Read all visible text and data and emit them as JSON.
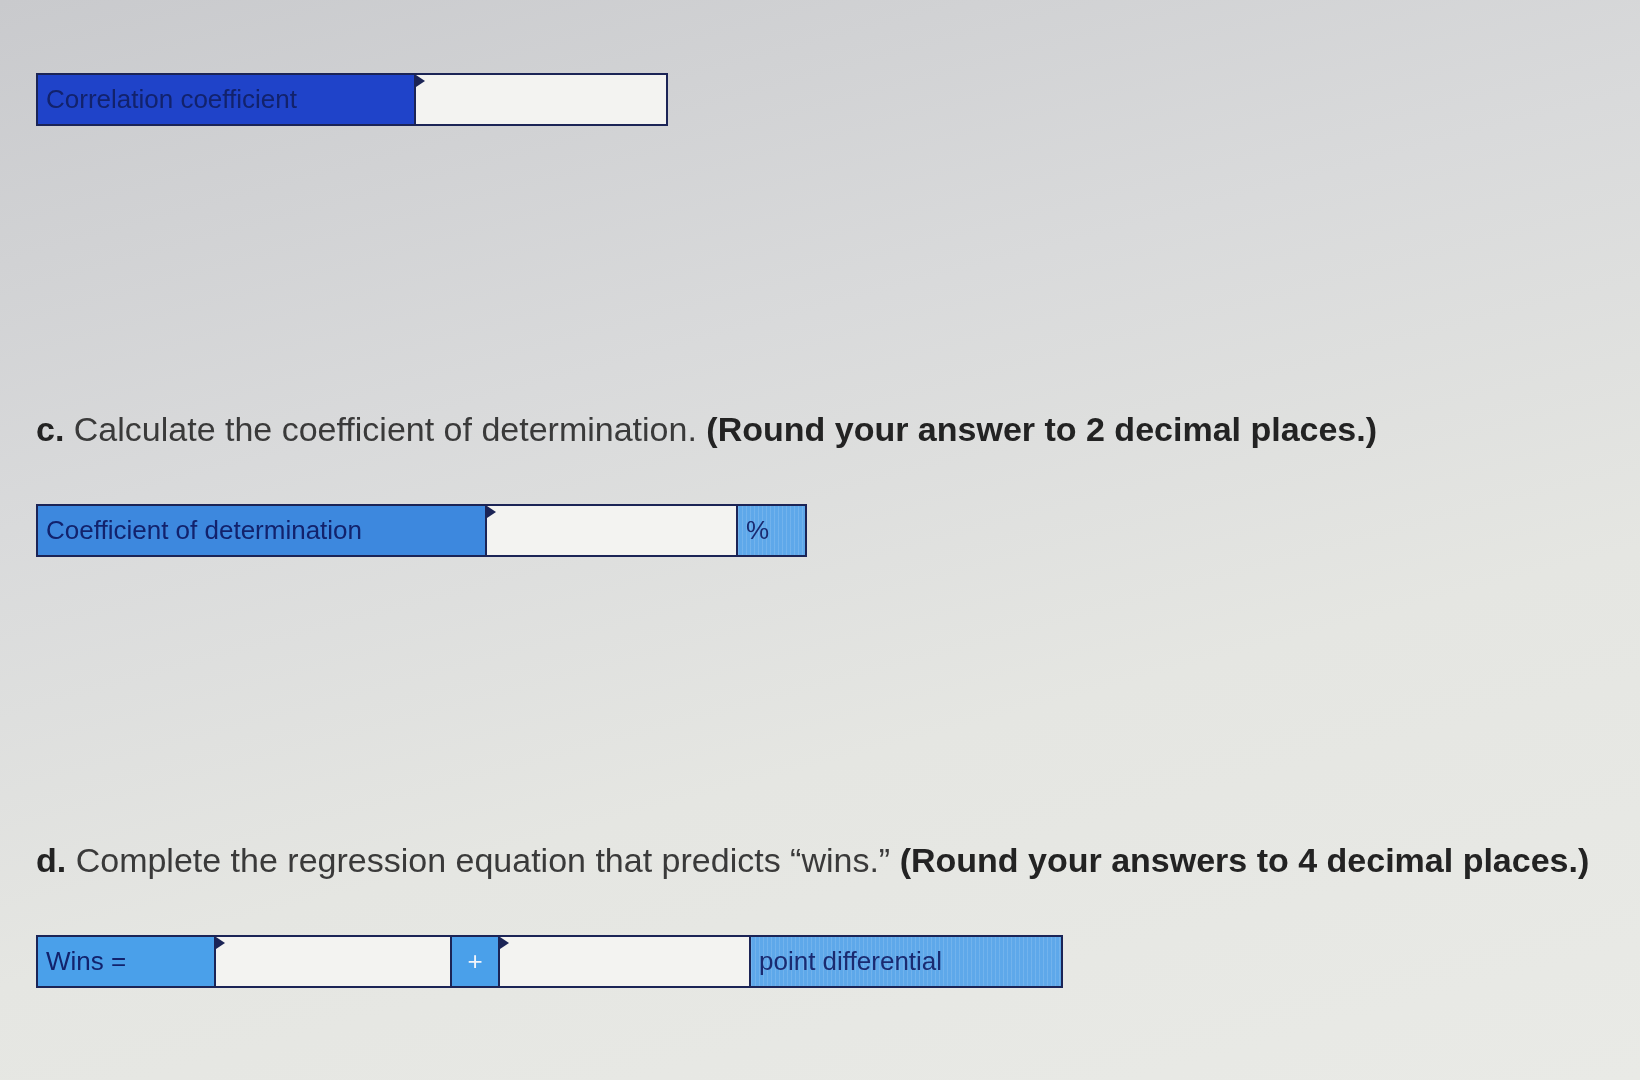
{
  "sections": [
    {
      "answer_row": [
        {
          "kind": "label",
          "text": "Correlation coefficient",
          "color": "#1f43c9"
        },
        {
          "kind": "input"
        }
      ]
    },
    {
      "question": "**c.** Calculate the coefficient of determination. **(Round your answer to 2 decimal places.)**",
      "answer_row": [
        {
          "kind": "label",
          "text": "Coefficient of determination",
          "color": "#3d88de"
        },
        {
          "kind": "input"
        },
        {
          "kind": "unit",
          "text": "%",
          "color": "#5ea8ea"
        }
      ]
    },
    {
      "question": "**d.** Complete the regression equation that predicts “wins.” **(Round your answers to 4 decimal places.)**",
      "answer_row": [
        {
          "kind": "label",
          "text": "Wins =",
          "color": "#4aa0ea"
        },
        {
          "kind": "input"
        },
        {
          "kind": "operator",
          "text": "+",
          "color": "#4aa0ea"
        },
        {
          "kind": "input"
        },
        {
          "kind": "unit",
          "text": "point differential",
          "color": "#5ea8ea"
        }
      ]
    }
  ]
}
